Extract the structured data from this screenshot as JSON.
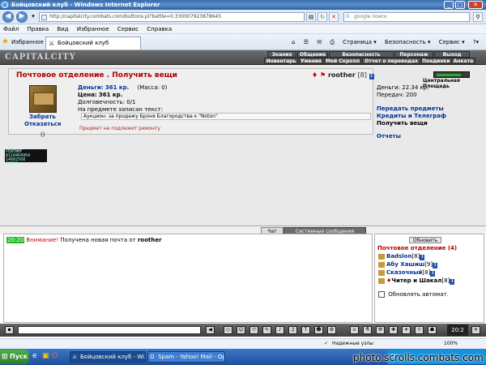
{
  "window": {
    "title": "Бойцовский клуб - Windows Internet Explorer"
  },
  "addressbar": {
    "url": "http://capitalcity.combats.com/buttons.pl?battle=0.330007923878645",
    "search_placeholder": "google поиск"
  },
  "menubar": {
    "items": [
      "Файл",
      "Правка",
      "Вид",
      "Избранное",
      "Сервис",
      "Справка"
    ]
  },
  "favbar": {
    "favorites_label": "Избранное",
    "tab_title": "Бойцовский клуб",
    "commands": [
      "Страница ▾",
      "Безопасность ▾",
      "Сервис ▾"
    ]
  },
  "game_header": {
    "logo": "CAPITALCITY",
    "nav_top": [
      "Знания",
      "Общение",
      "Безопасность",
      "Персонаж",
      "Выход"
    ],
    "nav_bottom": [
      "Инвентарь",
      "Умения",
      "Мой Скролл",
      "Отчет о переводах",
      "Поединки",
      "Анкета"
    ]
  },
  "main": {
    "title": "Почтовое отделение .  Получить вещи",
    "owner": {
      "name": "roother",
      "level": "[8]"
    },
    "item": {
      "action_take": "Забрать",
      "action_refuse": "Отказаться",
      "count": "()",
      "money_label": "Деньги:",
      "money_value": "361 кр.",
      "mass": "(Масса: 0)",
      "price_label": "Цена:",
      "price_value": "361 кр.",
      "durability": "Долговечность: 0/1",
      "note_label": "На предмете записан текст:",
      "note_text": "Аукцион: за продажу Броня Благородства к \"Noton\"",
      "repair_note": "Предмет не подлежит ремонту"
    },
    "side": {
      "location": "Центральная Площадь",
      "money": "Деньги: 22.34 кр.",
      "transfers": "Передач: 200",
      "links": [
        "Передать предметы",
        "Кредиты и Телеграф",
        "Получить вещи",
        "Отчеты"
      ]
    },
    "counter": {
      "label": "РЕЙТИНГ",
      "values": [
        "8110464954",
        "14602568",
        "42334"
      ]
    }
  },
  "chat": {
    "tabs": [
      "Чат",
      "Системные сообщения"
    ],
    "message": {
      "time": "20:20",
      "warning": "Внимание!",
      "text": " Получена новая почта от ",
      "nick": "roother"
    }
  },
  "room": {
    "refresh_label": "Обновить",
    "title": "Почтовое отделение (4)",
    "users": [
      {
        "name": "Badslon",
        "level": "[8]"
      },
      {
        "name": "Абу Хашиш",
        "level": "[9]"
      },
      {
        "name": "Сказочный",
        "level": "[8]"
      },
      {
        "name": "Читер и Шакал",
        "level": "[8]"
      }
    ],
    "auto_update_label": "Обновлять автомат."
  },
  "bottombar": {
    "clock": "20:2"
  },
  "statusbar": {
    "zone": "Надежные узлы",
    "zoom": "100%"
  },
  "taskbar": {
    "start": "Пуск",
    "tasks": [
      "Бойцовский клуб - Wi...",
      "Spam - Yahoo! Mail - Opera"
    ],
    "lang": "EN"
  },
  "watermark": "photo.scrolls.combats.com"
}
